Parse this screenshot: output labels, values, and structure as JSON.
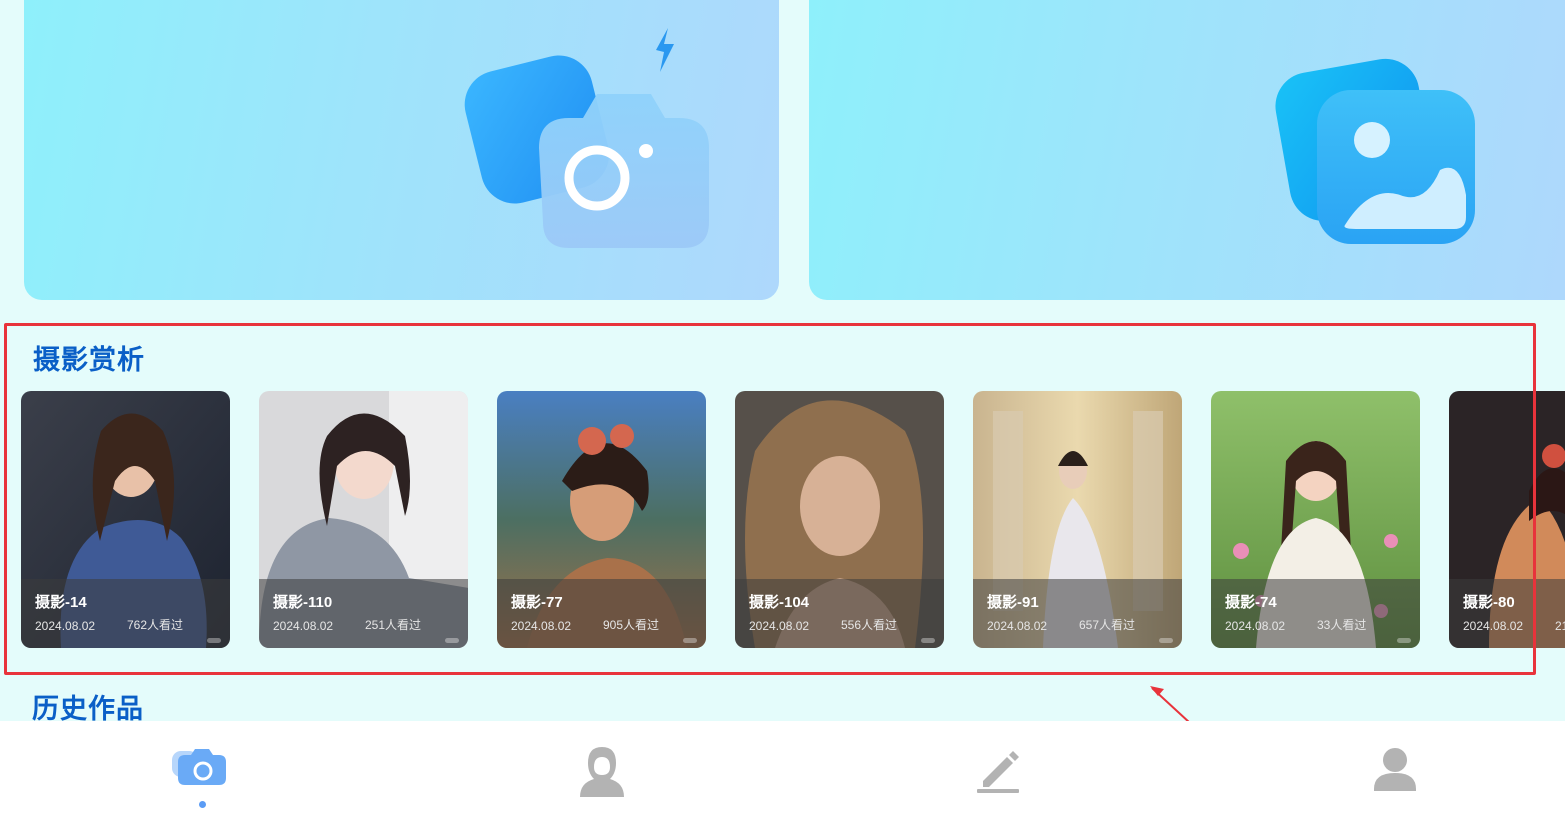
{
  "hero_cards": [
    {
      "icon": "camera-icon"
    },
    {
      "icon": "image-icon"
    }
  ],
  "gallery": {
    "title": "摄影赏析",
    "cards": [
      {
        "name": "摄影-14",
        "date": "2024.08.02",
        "views": "762人看过"
      },
      {
        "name": "摄影-110",
        "date": "2024.08.02",
        "views": "251人看过"
      },
      {
        "name": "摄影-77",
        "date": "2024.08.02",
        "views": "905人看过"
      },
      {
        "name": "摄影-104",
        "date": "2024.08.02",
        "views": "556人看过"
      },
      {
        "name": "摄影-91",
        "date": "2024.08.02",
        "views": "657人看过"
      },
      {
        "name": "摄影-74",
        "date": "2024.08.02",
        "views": "33人看过"
      },
      {
        "name": "摄影-80",
        "date": "2024.08.02",
        "views": "21"
      }
    ]
  },
  "history": {
    "title": "历史作品"
  },
  "tab_bar": {
    "tabs": [
      {
        "icon": "camera-icon",
        "active": true
      },
      {
        "icon": "portrait-icon",
        "active": false
      },
      {
        "icon": "pencil-icon",
        "active": false
      },
      {
        "icon": "user-icon",
        "active": false
      }
    ],
    "active_color": "#5b9cf5",
    "inactive_color": "#b3b3b3"
  },
  "annotation_color": "#e8333b"
}
